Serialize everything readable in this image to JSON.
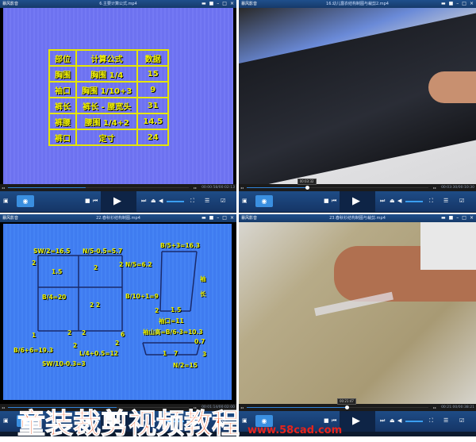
{
  "players": [
    {
      "app_name": "暴风影音",
      "file_title": "6.主要计算公式.mp4",
      "time": "00:00:58/00:02:13",
      "progress": 0.43,
      "tooltip": ""
    },
    {
      "app_name": "暴风影音",
      "file_title": "16.幼儿露衣结构制图与裁剪2.mp4",
      "time": "00:03:30/00:10:30",
      "progress": 0.33,
      "tooltip": "00:03:32"
    },
    {
      "app_name": "暴风影音",
      "file_title": "22.春秋衫结构制图.mp4",
      "time": "00:01:14/00:02:00",
      "progress": 0.6,
      "tooltip": ""
    },
    {
      "app_name": "暴风影音",
      "file_title": "23.春秋衫结构制图与裁剪.mp4",
      "time": "00:21:00/00:38:21",
      "progress": 0.55,
      "tooltip": "00:21:47"
    }
  ],
  "formula_table": {
    "headers": [
      "部位",
      "计算公式",
      "数据"
    ],
    "rows": [
      [
        "胸围",
        "胸围 1/4",
        "15"
      ],
      [
        "袖口",
        "胸围 1/10+3",
        "9"
      ],
      [
        "裤长",
        "裤长 - 腰宽头",
        "31"
      ],
      [
        "裤腰",
        "腰围 1/4+2",
        "14.5"
      ],
      [
        "裤口",
        "定寸",
        "24"
      ]
    ]
  },
  "diagram_labels": [
    "SW/2=16.5",
    "N/5-0.5=5.7",
    "2",
    "1.5",
    "2",
    "2 N/5=6.2",
    "B/4=20",
    "B/10+1=9",
    "2 2",
    "1",
    "2",
    "2",
    "6",
    "2",
    "2",
    "B/6+6=19.3",
    "L/4+0.5=12",
    "SW/10-0.3=3",
    "B/5+3=16.3",
    "袖",
    "长",
    "2",
    "1.5",
    "袖口=11",
    "袖山高=B/6-3=10.3",
    "0.7",
    "1",
    "7",
    "3",
    "N/2=15"
  ],
  "watermark": {
    "title": "童装裁剪视频教程",
    "url": "www.58cad.com"
  },
  "colors": {
    "accent": "#2f82d8",
    "screen_blue": "#6d72f0",
    "label_yellow": "#e8f000",
    "watermark": "#ee5a2a"
  }
}
